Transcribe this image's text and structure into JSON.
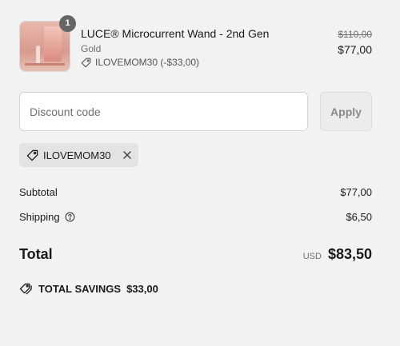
{
  "product": {
    "quantity": "1",
    "name": "LUCE® Microcurrent Wand - 2nd Gen",
    "variant": "Gold",
    "discount_text": "ILOVEMOM30 (-$33,00)",
    "original_price": "$110,00",
    "price": "$77,00"
  },
  "discount": {
    "placeholder": "Discount code",
    "apply_label": "Apply",
    "applied_code": "ILOVEMOM30"
  },
  "summary": {
    "subtotal_label": "Subtotal",
    "subtotal_value": "$77,00",
    "shipping_label": "Shipping",
    "shipping_value": "$6,50",
    "total_label": "Total",
    "currency": "USD",
    "total_value": "$83,50",
    "savings_label": "TOTAL SAVINGS",
    "savings_value": "$33,00"
  }
}
